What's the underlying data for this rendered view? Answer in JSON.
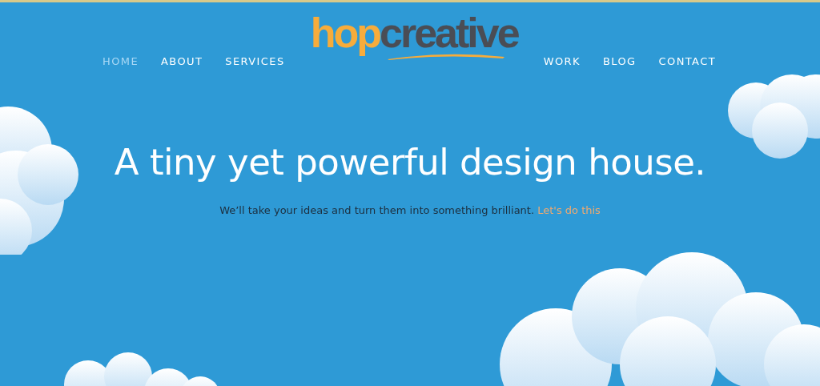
{
  "logo": {
    "part_1": "hop",
    "part_2": "creative"
  },
  "nav_left": [
    {
      "label": "HOME",
      "selected": true
    },
    {
      "label": "ABOUT",
      "selected": false
    },
    {
      "label": "SERVICES",
      "selected": false
    }
  ],
  "nav_right": [
    {
      "label": "WORK",
      "selected": false
    },
    {
      "label": "BLOG",
      "selected": false
    },
    {
      "label": "CONTACT",
      "selected": false
    }
  ],
  "hero": {
    "headline": "A tiny yet powerful design house.",
    "tagline": "We’ll take your ideas and turn them into something brilliant.",
    "link": "Let's do this"
  }
}
